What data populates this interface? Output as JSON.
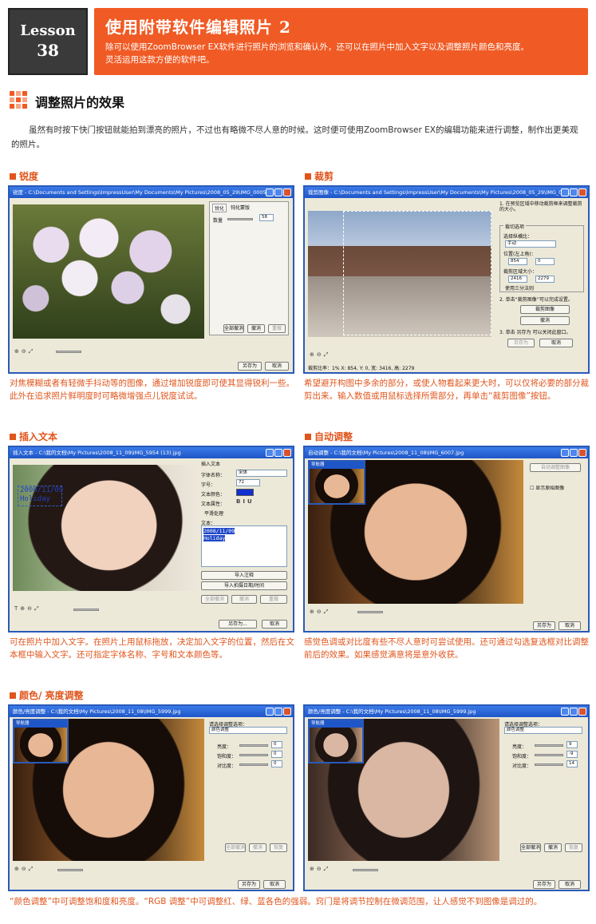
{
  "header": {
    "lesson_word": "Lesson",
    "lesson_number": "38",
    "title": "使用附带软件编辑照片 2",
    "desc_line1": "除可以使用ZoomBrowser EX软件进行照片的浏览和确认外，还可以在照片中加入文字以及调整照片颜色和亮度。",
    "desc_line2": "灵活运用这款方便的软件吧。"
  },
  "section": {
    "title": "调整照片的效果",
    "intro": "虽然有时按下快门按钮就能拍到漂亮的照片，不过也有略微不尽人意的时候。这时便可使用ZoomBrowser EX的编辑功能来进行调整，制作出更美观的照片。"
  },
  "sharpness": {
    "heading": "锐度",
    "window_title": "锐度 - C:\\Documents and Settings\\ImpressUser\\My Documents\\My Pictures\\2008_05_29\\IMG_0005.JPG",
    "tab1": "锐化",
    "tab2": "钝化蒙版",
    "amount_label": "数量",
    "amount_value": "58",
    "btn_reset": "全部撤消",
    "btn_undo": "撤消",
    "btn_redo": "重做",
    "btn_save": "另存为",
    "btn_cancel": "取消",
    "caption": "对焦模糊或者有轻微手抖动等的图像，通过增加锐度即可使其显得锐利一些。此外在追求照片鲜明度时可略微增强点儿锐度试试。"
  },
  "crop": {
    "heading": "裁剪",
    "window_title": "裁剪图像 - C:\\Documents and Settings\\ImpressUser\\My Documents\\My Pictures\\2008_05_29\\IMG_000...",
    "step1": "1. 在预览区域中移动裁剪框来调整裁剪的大小。",
    "group_label": "裁切选项",
    "ratio_label": "选择纵横比：",
    "ratio_value": "手动",
    "pos_label": "位置(左上角)：",
    "pos_x": "854",
    "pos_y": "0",
    "size_label": "裁剪区域大小：",
    "size_w": "2416",
    "size_h": "2279",
    "grid_label": "使用三分法则",
    "step2": "2. 单击“裁剪图像”可以完成设置。",
    "btn_crop": "裁剪图像",
    "btn_undo": "撤消",
    "step3": "3. 单击 另存为 可以关闭此窗口。",
    "btn_save": "另存为",
    "btn_cancel": "取消",
    "status": "裁剪比率：1%    X: 854, Y: 0,  宽: 3416, 高: 2279",
    "caption": "希望避开构图中多余的部分，或使人物看起来更大时，可以仅将必要的部分裁剪出来。输入数值或用鼠标选择所需部分，再单击“裁剪图像”按钮。"
  },
  "insert_text": {
    "heading": "插入文本",
    "window_title": "插入文本 - C:\\我的文档\\My Pictures\\2008_11_09\\IMG_5954 (13).jpg",
    "panel_title": "插入文本",
    "font_label": "字体名称：",
    "font_value": "宋体",
    "size_label": "字号：",
    "size_value": "72",
    "color_label": "文本颜色：",
    "style_label": "文本属性：",
    "smooth_label": "平滑处理",
    "text_label": "文本：",
    "overlay_line1": "2008/11/09",
    "overlay_line2": "Holiday",
    "btn_import": "导入注释",
    "btn_import_date": "导入拍摄日期/时间",
    "btn_reset": "全部撤消",
    "btn_undo": "撤消",
    "btn_redo": "重做",
    "btn_save": "另存为...",
    "btn_cancel": "取消",
    "caption": "可在照片中加入文字。在照片上用鼠标拖放，决定加入文字的位置，然后在文本框中输入文字。还可指定字体名称、字号和文本颜色等。"
  },
  "auto_adjust": {
    "heading": "自动调整",
    "window_title": "自动调整 - C:\\我的文档\\My Pictures\\2008_11_08\\IMG_6007.jpg",
    "nav_label": "导航器",
    "btn_auto": "自动调整图像",
    "compare_label": "显示原始图像",
    "btn_save": "另存为",
    "btn_cancel": "取消",
    "caption": "感觉色调或对比度有些不尽人意时可尝试使用。还可通过勾选复选框对比调整前后的效果。如果感觉满意将是意外收获。"
  },
  "color_brightness": {
    "heading": "颜色/ 亮度调整",
    "window_title": "颜色/亮度调整 - C:\\我的文档\\My Pictures\\2008_11_08\\IMG_5999.jpg",
    "nav_label": "导航器",
    "mode_label": "请选择调整选项：",
    "mode_value": "颜色调整",
    "brightness_label": "亮度：",
    "saturation_label": "饱和度：",
    "contrast_label": "对比度：",
    "left_values": [
      "0",
      "0",
      "0"
    ],
    "right_values": [
      "9",
      "-9",
      "14"
    ],
    "btn_reset": "全部撤消",
    "btn_undo": "撤消",
    "btn_redo": "恢复",
    "btn_save": "另存为",
    "btn_cancel": "取消",
    "caption": "“颜色调整”中可调整饱和度和亮度。“RGB 调整”中可调整红、绿、蓝各色的强弱。窍门是将调节控制在微调范围，让人感觉不到图像是调过的。"
  },
  "colors": {
    "accent": "#f05a24",
    "heading": "#e0551c",
    "window_blue": "#2a5ab8"
  }
}
